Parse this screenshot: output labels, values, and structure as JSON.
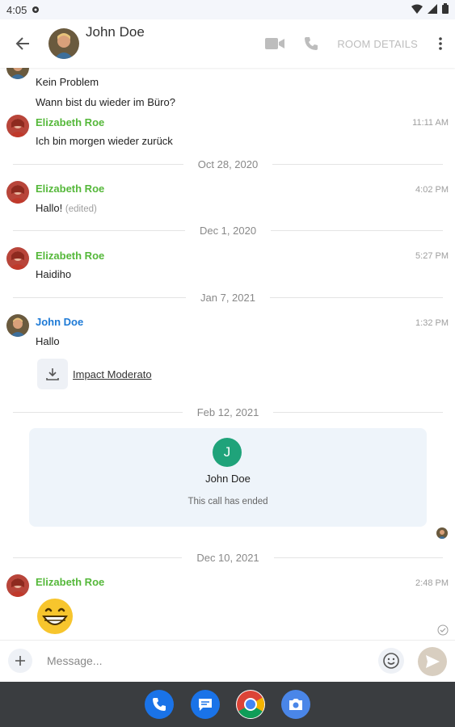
{
  "status_bar": {
    "time": "4:05"
  },
  "header": {
    "title": "John Doe",
    "room_details_label": "ROOM DETAILS"
  },
  "messages_top": [
    {
      "text": "Kein Problem"
    },
    {
      "text": "Wann bist du wieder im Büro?"
    }
  ],
  "groups": [
    {
      "sender": "Elizabeth Roe",
      "time": "11:11 AM",
      "text": "Ich bin morgen wieder zurück"
    },
    {
      "sender": "Elizabeth Roe",
      "time": "4:02 PM",
      "text": "Hallo!",
      "edited": "(edited)"
    },
    {
      "sender": "Elizabeth Roe",
      "time": "5:27 PM",
      "text": "Haidiho"
    },
    {
      "sender": "John Doe",
      "time": "1:32 PM",
      "text": "Hallo",
      "file": "Impact Moderato"
    },
    {
      "sender": "Elizabeth Roe",
      "time": "2:48 PM"
    }
  ],
  "dividers": [
    "Oct 28, 2020",
    "Dec 1, 2020",
    "Jan 7, 2021",
    "Feb 12, 2021",
    "Dec 10, 2021"
  ],
  "call": {
    "initial": "J",
    "name": "John Doe",
    "status": "This call has ended"
  },
  "composer": {
    "placeholder": "Message..."
  },
  "colors": {
    "elizabeth": "#55b83a",
    "john": "#1e7ad6",
    "call_avatar": "#1fa37a"
  },
  "dock": [
    "phone-icon",
    "messages-icon",
    "chrome-icon",
    "camera-icon"
  ]
}
